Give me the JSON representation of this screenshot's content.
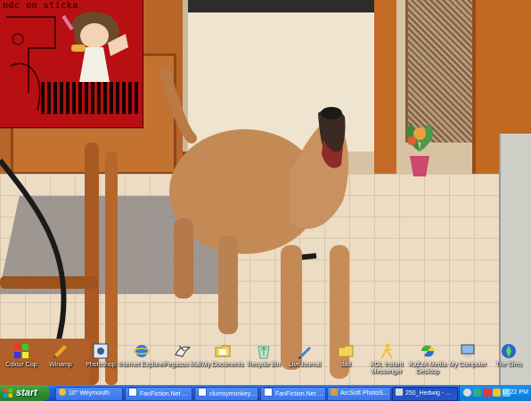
{
  "sticker_window": {
    "caption": "ndc on sticka"
  },
  "desktop_icons": [
    {
      "label": "Colour Cop",
      "icon": "colour-cop-icon"
    },
    {
      "label": "Winamp",
      "icon": "winamp-icon"
    },
    {
      "label": "Photoshop",
      "icon": "photoshop-icon"
    },
    {
      "label": "Internet Explorer",
      "icon": "internet-explorer-icon"
    },
    {
      "label": "Pegasus Mail",
      "icon": "pegasus-mail-icon"
    },
    {
      "label": "My Documents",
      "icon": "my-documents-icon"
    },
    {
      "label": "Recycle Bin",
      "icon": "recycle-bin-icon"
    },
    {
      "label": "LiveJournal",
      "icon": "livejournal-icon"
    },
    {
      "label": "dad",
      "icon": "folder-icon"
    },
    {
      "label": "AOL Instant Messenger",
      "icon": "aim-icon"
    },
    {
      "label": "KaZaA Media Desktop",
      "icon": "kazaa-icon"
    },
    {
      "label": "My Computer",
      "icon": "my-computer-icon"
    },
    {
      "label": "The Sims",
      "icon": "the-sims-icon"
    }
  ],
  "taskbar": {
    "start_label": "start",
    "tasks": [
      {
        "label": "10° Weymouth",
        "icon": "weather-icon",
        "active": false
      },
      {
        "label": "FanFiction.Net ...",
        "icon": "ie-page-icon",
        "active": false
      },
      {
        "label": "clumsymonkey....",
        "icon": "ie-page-icon",
        "active": false
      },
      {
        "label": "FanFiction.Net ...",
        "icon": "ie-page-icon",
        "active": false
      },
      {
        "label": "ArcSoft PhotoS...",
        "icon": "arcsoft-icon",
        "active": false
      },
      {
        "label": "250_Hedwig - ...",
        "icon": "image-viewer-icon",
        "active": true
      }
    ],
    "tray": {
      "clock": "11:22 PM",
      "icons": [
        "speaker-icon",
        "network-icon",
        "shield-icon",
        "messenger-icon",
        "update-icon"
      ]
    }
  },
  "colors": {
    "taskbar_blue": "#245edb",
    "start_green": "#2f8f2f",
    "tray_blue": "#0f79d8",
    "sticker_red": "#b80f12"
  }
}
